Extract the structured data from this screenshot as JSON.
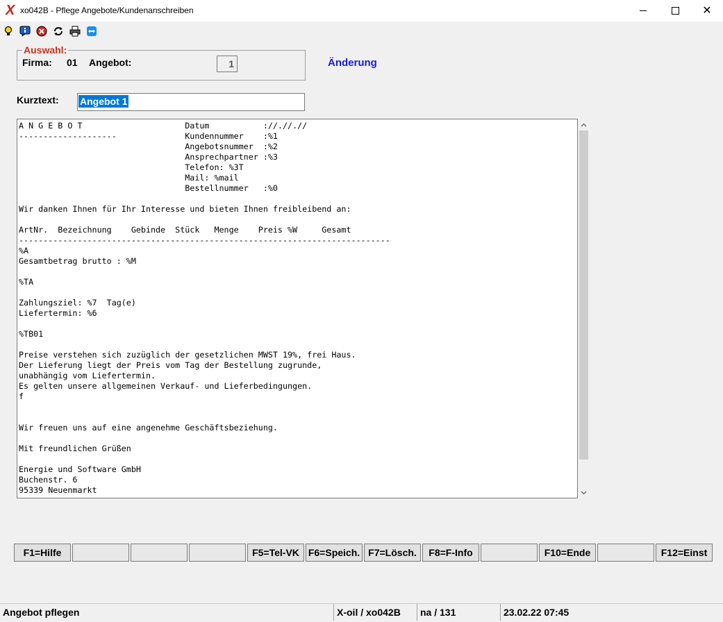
{
  "window": {
    "logo": "X",
    "title": "xo042B - Pflege Angebote/Kundenanschreiben",
    "min_glyph": "—",
    "max_glyph": "☐",
    "close_glyph": "✕"
  },
  "toolbar": {
    "icons": [
      "lightbulb-icon",
      "info-icon",
      "stop-icon",
      "refresh-icon",
      "print-icon",
      "teamviewer-icon"
    ]
  },
  "auswahl": {
    "legend": "Auswahl:",
    "firma_label": "Firma:",
    "firma_value": "01",
    "angebot_label": "Angebot:",
    "angebot_value": "1",
    "mode": "Änderung"
  },
  "kurztext": {
    "label": "Kurztext:",
    "value": "Angebot 1"
  },
  "document": {
    "lines": [
      "A N G E B O T                     Datum           ://.//.//",
      "--------------------              Kundennummer    :%1",
      "                                  Angebotsnummer  :%2",
      "                                  Ansprechpartner :%3",
      "                                  Telefon: %3T",
      "                                  Mail: %mail",
      "                                  Bestellnummer   :%0",
      "",
      "Wir danken Ihnen für Ihr Interesse und bieten Ihnen freibleibend an:",
      "",
      "ArtNr.  Bezeichnung    Gebinde  Stück   Menge    Preis %W     Gesamt",
      "----------------------------------------------------------------------------",
      "%A",
      "Gesamtbetrag brutto : %M",
      "",
      "%TA",
      "",
      "Zahlungsziel: %7  Tag(e)",
      "Liefertermin: %6",
      "",
      "%TB01",
      "",
      "Preise verstehen sich zuzüglich der gesetzlichen MWST 19%, frei Haus.",
      "Der Lieferung liegt der Preis vom Tag der Bestellung zugrunde,",
      "unabhängig vom Liefertermin.",
      "Es gelten unsere allgemeinen Verkauf- und Lieferbedingungen.",
      "f",
      "",
      "",
      "Wir freuen uns auf eine angenehme Geschäftsbeziehung.",
      "",
      "Mit freundlichen Grüßen",
      "",
      "Energie und Software GmbH",
      "Buchenstr. 6",
      "95339 Neuenmarkt"
    ]
  },
  "fkeys": [
    "F1=Hilfe",
    "",
    "",
    "",
    "F5=Tel-VK",
    "F6=Speich.",
    "F7=Lösch.",
    "F8=F-Info",
    "",
    "F10=Ende",
    "",
    "F12=Einst"
  ],
  "status": {
    "left": "Angebot pflegen",
    "program": "X-oil / xo042B",
    "user": "na / 131",
    "datetime": "23.02.22 07:45"
  }
}
